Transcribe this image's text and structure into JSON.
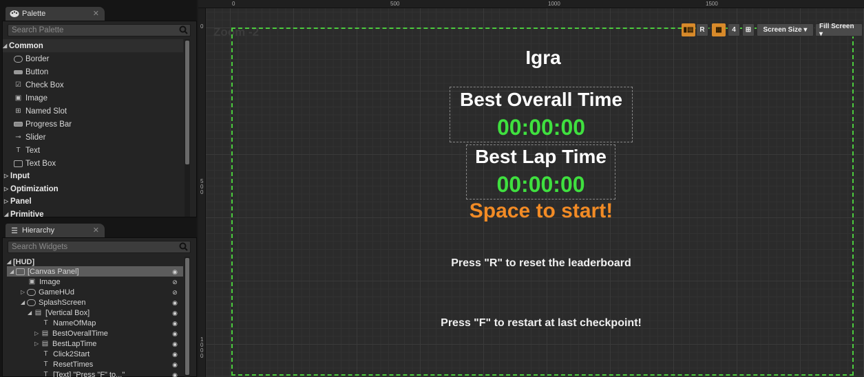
{
  "palette": {
    "tab_label": "Palette",
    "search_placeholder": "Search Palette",
    "categories": [
      {
        "label": "Common",
        "expanded": true
      },
      {
        "label": "Input",
        "expanded": false
      },
      {
        "label": "Optimization",
        "expanded": false
      },
      {
        "label": "Panel",
        "expanded": false
      },
      {
        "label": "Primitive",
        "expanded": true
      }
    ],
    "items": [
      "Border",
      "Button",
      "Check Box",
      "Image",
      "Named Slot",
      "Progress Bar",
      "Slider",
      "Text",
      "Text Box"
    ]
  },
  "hierarchy": {
    "tab_label": "Hierarchy",
    "search_placeholder": "Search Widgets",
    "rows": [
      "[HUD]",
      "[Canvas Panel]",
      "Image",
      "GameHUd",
      "SplashScreen",
      "[Vertical Box]",
      "NameOfMap",
      "BestOverallTime",
      "BestLapTime",
      "Click2Start",
      "ResetTimes",
      "[Text] \"Press \"F\" to...\""
    ]
  },
  "designer": {
    "zoom_label": "Zoom -2",
    "ruler_top": [
      "0",
      "500",
      "1000",
      "1500"
    ],
    "ruler_left": [
      "0",
      "5 0 0",
      "1 0 0 0"
    ],
    "toolbar": {
      "r_label": "R",
      "grid_size": "4",
      "screen_size_label": "Screen Size ▾",
      "fill_screen_label": "Fill Screen ▾"
    }
  },
  "canvas": {
    "title": "Igra",
    "best_overall_label": "Best Overall Time",
    "best_overall_value": "00:00:00",
    "best_lap_label": "Best Lap Time",
    "best_lap_value": "00:00:00",
    "start_prompt": "Space to start!",
    "reset_hint": "Press \"R\" to reset the leaderboard",
    "restart_hint": "Press \"F\" to restart at last checkpoint!"
  },
  "colors": {
    "accent_orange": "#f28b25",
    "time_green": "#3fe03f",
    "frame_green": "#4ccd3e"
  }
}
